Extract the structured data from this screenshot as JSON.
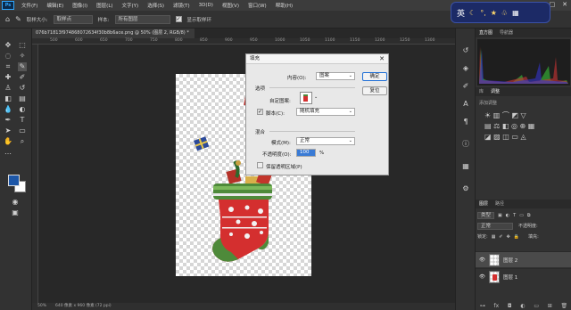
{
  "menubar": {
    "logo": "Ps",
    "items": [
      "文件(F)",
      "编辑(E)",
      "图像(I)",
      "图层(L)",
      "文字(Y)",
      "选择(S)",
      "滤镜(T)",
      "3D(D)",
      "视图(V)",
      "窗口(W)",
      "帮助(H)"
    ],
    "minimize": "—",
    "maximize": "□",
    "close": "✕"
  },
  "options": {
    "sample_size_label": "取样大小:",
    "sample_size_value": "取样点",
    "sample_label": "样本:",
    "sample_value": "所有图层",
    "show_ring_label": "显示取样环"
  },
  "ime": {
    "lang": "英"
  },
  "document": {
    "tab_title": "076b71813f974868072634f30b8b6ace.png @ 50% (图层 2, RGB/8) *",
    "ruler_ticks": [
      "500",
      "600",
      "650",
      "700",
      "750",
      "800",
      "850",
      "900",
      "950",
      "1000",
      "1050",
      "1100",
      "1150",
      "1200",
      "1250",
      "1300"
    ]
  },
  "status": {
    "zoom": "50%",
    "size": "640 像素 x 960 像素 (72 ppi)"
  },
  "dialog": {
    "title": "填充",
    "content_label": "内容(O):",
    "content_value": "图案",
    "options_heading": "选项",
    "custom_pattern_label": "自定图案:",
    "script_label": "脚本(C):",
    "script_value": "随机填充",
    "blend_heading": "混合",
    "mode_label": "模式(M):",
    "mode_value": "正常",
    "opacity_label": "不透明度(O):",
    "opacity_value": "100",
    "opacity_unit": "%",
    "preserve_label": "保留透明区域(P)",
    "ok_label": "确定",
    "cancel_label": "复位"
  },
  "panels": {
    "histogram_tabs": [
      "直方图",
      "导航器"
    ],
    "adjust_tabs": [
      "库",
      "调整"
    ],
    "adjust_heading": "添加调整",
    "layers_tabs": [
      "图层",
      "路径"
    ],
    "layers_kind": "类型",
    "blend_mode": "正常",
    "opacity_label": "不透明度:",
    "lock_label": "锁定:",
    "fill_label": "填充:",
    "layers": [
      {
        "name": "图层 2",
        "selected": true
      },
      {
        "name": "图层 1",
        "selected": false
      }
    ]
  },
  "colors": {
    "accent": "#31a8ff",
    "foreground": "#1d57a8",
    "background": "#ffffff"
  }
}
